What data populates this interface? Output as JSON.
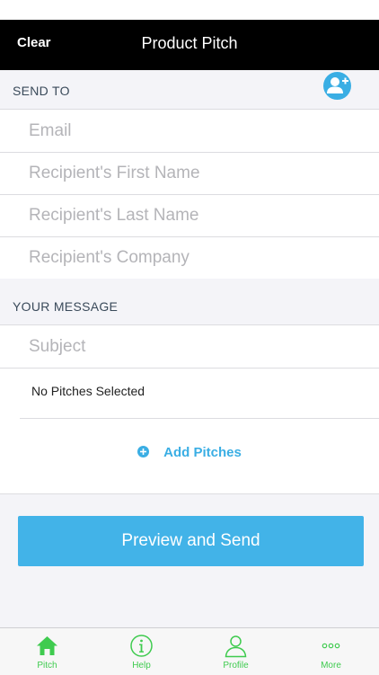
{
  "colors": {
    "accent": "#3aaee4",
    "tab_green": "#3fcb4f",
    "nav_bg": "#000000"
  },
  "nav": {
    "clear_label": "Clear",
    "title": "Product Pitch"
  },
  "send_to": {
    "header": "SEND TO",
    "add_contact_icon": "add-contact-icon",
    "fields": {
      "email_placeholder": "Email",
      "first_name_placeholder": "Recipient's First Name",
      "last_name_placeholder": "Recipient's Last Name",
      "company_placeholder": "Recipient's Company"
    }
  },
  "message": {
    "header": "YOUR MESSAGE",
    "subject_placeholder": "Subject",
    "pitches_status": "No Pitches Selected",
    "add_pitches_label": "Add Pitches",
    "add_pitches_icon": "plus-circle-icon"
  },
  "primary_action": {
    "label": "Preview and Send"
  },
  "tabs": [
    {
      "label": "Pitch",
      "icon": "home-icon"
    },
    {
      "label": "Help",
      "icon": "info-icon"
    },
    {
      "label": "Profile",
      "icon": "person-icon"
    },
    {
      "label": "More",
      "icon": "more-icon"
    }
  ]
}
